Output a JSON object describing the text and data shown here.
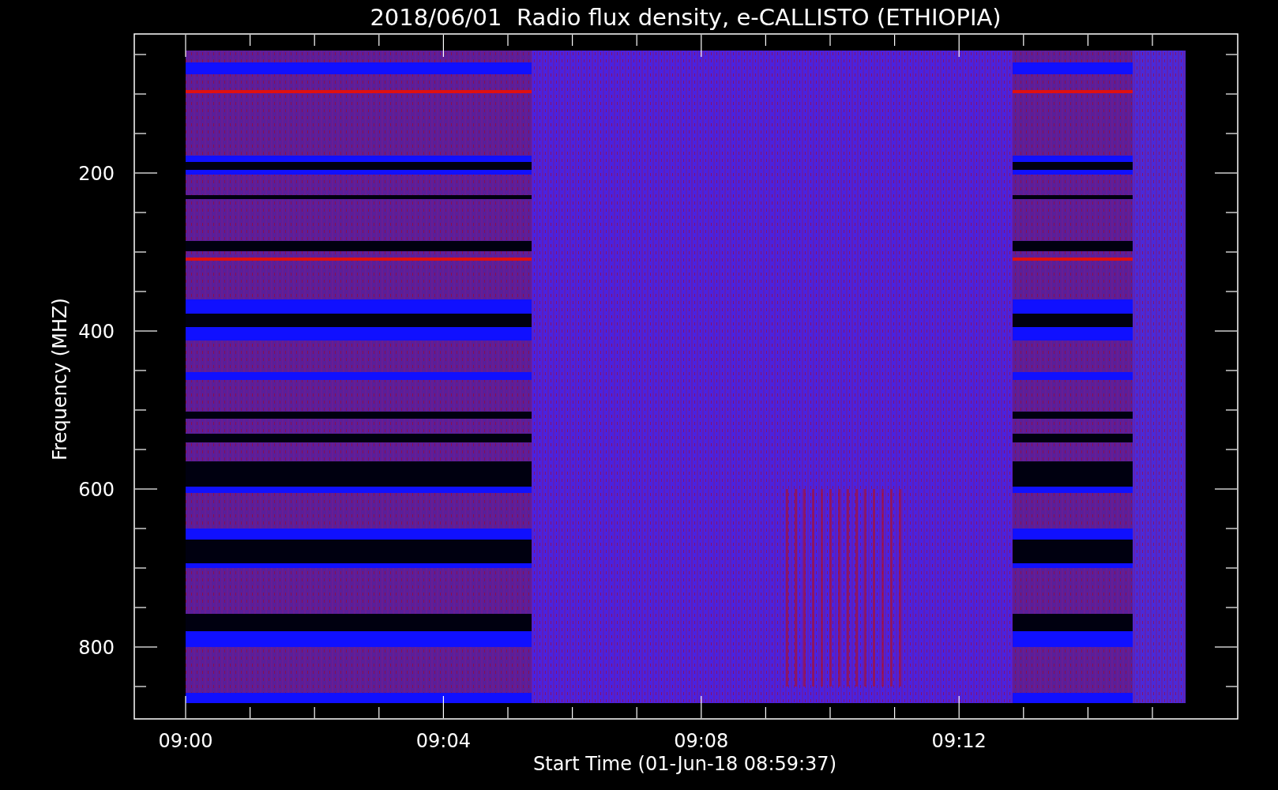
{
  "title": "2018/06/01  Radio flux density, e-CALLISTO (ETHIOPIA)",
  "y_axis": {
    "label": "Frequency (MHZ)",
    "ticks": [
      "200",
      "400",
      "600",
      "800"
    ]
  },
  "x_axis": {
    "label": "Start Time (01-Jun-18 08:59:37)",
    "ticks": [
      "09:00",
      "09:04",
      "09:08",
      "09:12"
    ]
  }
}
